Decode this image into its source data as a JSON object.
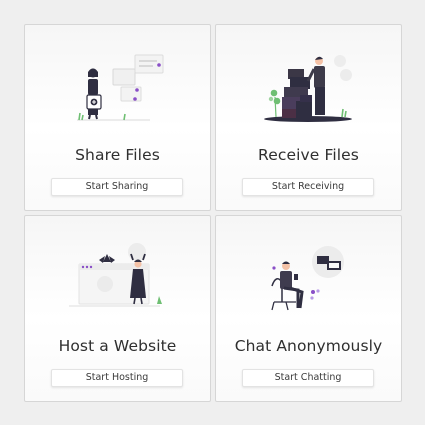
{
  "colors": {
    "accent": "#8a4fc7",
    "dark": "#2f2e41",
    "leaf": "#6fbf73"
  },
  "cards": [
    {
      "title": "Share Files",
      "button": "Start Sharing",
      "illustration": "person-sharing-file-illustration"
    },
    {
      "title": "Receive Files",
      "button": "Start Receiving",
      "illustration": "person-receiving-boxes-illustration"
    },
    {
      "title": "Host a Website",
      "button": "Start Hosting",
      "illustration": "person-hosting-website-illustration"
    },
    {
      "title": "Chat Anonymously",
      "button": "Start Chatting",
      "illustration": "person-chatting-illustration"
    }
  ]
}
